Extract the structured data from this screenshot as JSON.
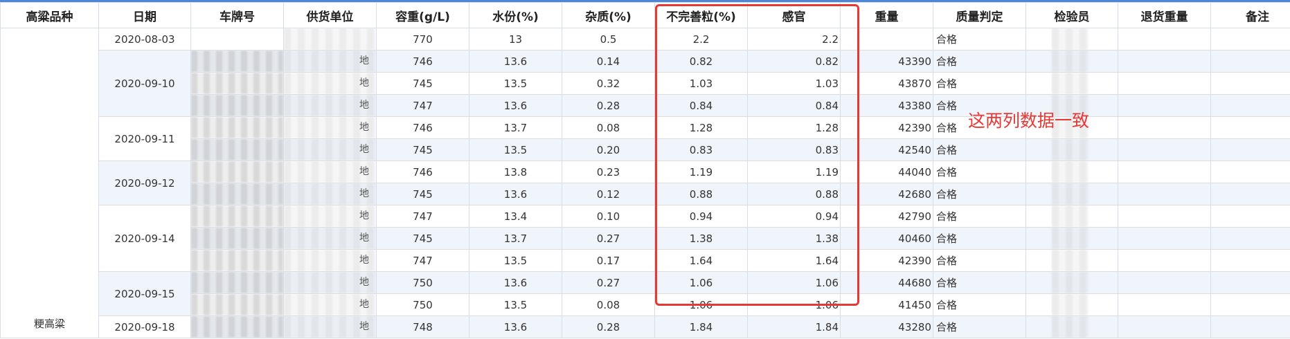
{
  "headers": [
    "高粱品种",
    "日期",
    "车牌号",
    "供货单位",
    "容重(g/L)",
    "水份(%)",
    "杂质(%)",
    "不完善粒(%)",
    "感官",
    "重量",
    "质量判定",
    "检验员",
    "退货重量",
    "备注"
  ],
  "variety": "粳高粱",
  "date_groups": [
    {
      "date": "2020-08-03",
      "rows": 1
    },
    {
      "date": "2020-09-10",
      "rows": 3
    },
    {
      "date": "2020-09-11",
      "rows": 2
    },
    {
      "date": "2020-09-12",
      "rows": 2
    },
    {
      "date": "2020-09-14",
      "rows": 3
    },
    {
      "date": "2020-09-15",
      "rows": 2
    },
    {
      "date": "2020-09-18",
      "rows": 1
    }
  ],
  "rows": [
    {
      "supplier": "",
      "density": "770",
      "moisture": "13",
      "impurity": "0.5",
      "imperfect": "2.2",
      "sensory": "2.2",
      "weight": "",
      "judgement": "合格"
    },
    {
      "supplier": "地",
      "density": "746",
      "moisture": "13.6",
      "impurity": "0.14",
      "imperfect": "0.82",
      "sensory": "0.82",
      "weight": "43390",
      "judgement": "合格"
    },
    {
      "supplier": "地",
      "density": "745",
      "moisture": "13.5",
      "impurity": "0.32",
      "imperfect": "1.03",
      "sensory": "1.03",
      "weight": "43870",
      "judgement": "合格"
    },
    {
      "supplier": "地",
      "density": "747",
      "moisture": "13.6",
      "impurity": "0.28",
      "imperfect": "0.84",
      "sensory": "0.84",
      "weight": "43380",
      "judgement": "合格"
    },
    {
      "supplier": "地",
      "density": "746",
      "moisture": "13.7",
      "impurity": "0.08",
      "imperfect": "1.28",
      "sensory": "1.28",
      "weight": "42390",
      "judgement": "合格"
    },
    {
      "supplier": "地",
      "density": "745",
      "moisture": "13.5",
      "impurity": "0.20",
      "imperfect": "0.83",
      "sensory": "0.83",
      "weight": "42540",
      "judgement": "合格"
    },
    {
      "supplier": "地",
      "density": "746",
      "moisture": "13.8",
      "impurity": "0.23",
      "imperfect": "1.19",
      "sensory": "1.19",
      "weight": "44040",
      "judgement": "合格"
    },
    {
      "supplier": "地",
      "density": "745",
      "moisture": "13.6",
      "impurity": "0.12",
      "imperfect": "0.88",
      "sensory": "0.88",
      "weight": "42680",
      "judgement": "合格"
    },
    {
      "supplier": "地",
      "density": "747",
      "moisture": "13.4",
      "impurity": "0.10",
      "imperfect": "0.94",
      "sensory": "0.94",
      "weight": "42790",
      "judgement": "合格"
    },
    {
      "supplier": "地",
      "density": "745",
      "moisture": "13.7",
      "impurity": "0.27",
      "imperfect": "1.38",
      "sensory": "1.38",
      "weight": "40460",
      "judgement": "合格"
    },
    {
      "supplier": "地",
      "density": "747",
      "moisture": "13.5",
      "impurity": "0.17",
      "imperfect": "1.64",
      "sensory": "1.64",
      "weight": "42390",
      "judgement": "合格"
    },
    {
      "supplier": "地",
      "density": "750",
      "moisture": "13.6",
      "impurity": "0.27",
      "imperfect": "1.06",
      "sensory": "1.06",
      "weight": "44680",
      "judgement": "合格"
    },
    {
      "supplier": "地",
      "density": "750",
      "moisture": "13.5",
      "impurity": "0.08",
      "imperfect": "1.06",
      "sensory": "1.06",
      "weight": "41450",
      "judgement": "合格"
    },
    {
      "supplier": "地",
      "density": "748",
      "moisture": "13.6",
      "impurity": "0.28",
      "imperfect": "1.84",
      "sensory": "1.84",
      "weight": "43280",
      "judgement": "合格"
    }
  ],
  "annotation": "这两列数据一致",
  "colors": {
    "accent": "#4e86d8",
    "annotation": "#e53935",
    "row_alt": "#f0f5fb",
    "border": "#d8dde6"
  }
}
